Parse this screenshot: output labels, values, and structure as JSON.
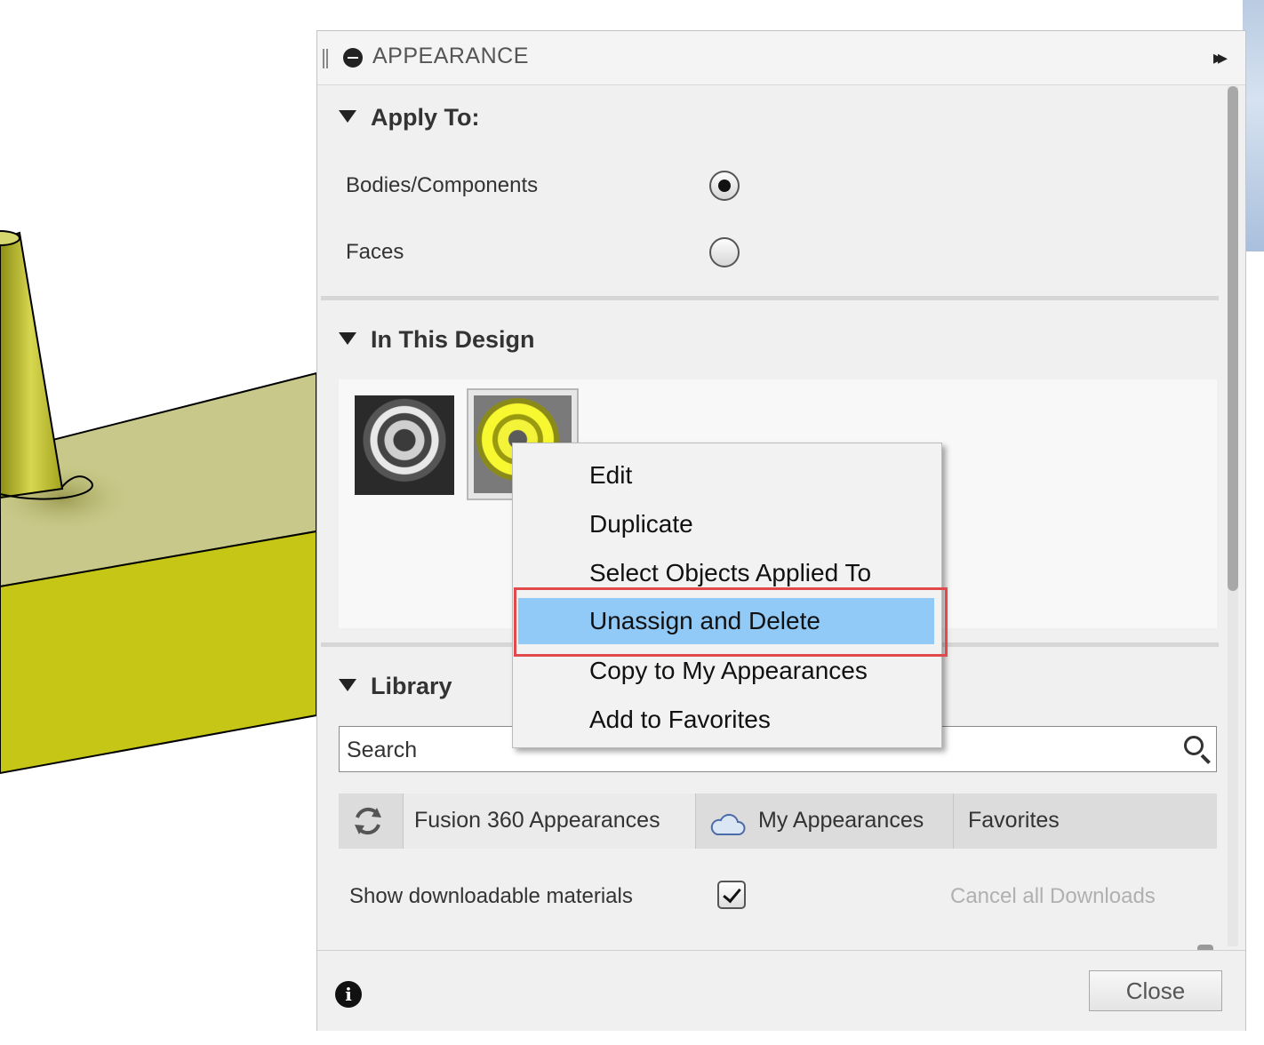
{
  "panel": {
    "title": "APPEARANCE",
    "expand_glyph": "▸▸"
  },
  "apply_to": {
    "heading": "Apply To:",
    "options": [
      {
        "label": "Bodies/Components",
        "selected": true
      },
      {
        "label": "Faces",
        "selected": false
      }
    ]
  },
  "in_this_design": {
    "heading": "In This Design",
    "swatches": [
      "chrome",
      "yellow"
    ]
  },
  "context_menu": {
    "items": [
      "Edit",
      "Duplicate",
      "Select Objects Applied To",
      "Unassign and Delete",
      "Copy to My Appearances",
      "Add to Favorites"
    ],
    "highlighted": "Unassign and Delete",
    "highlight_color": "#91c9f7",
    "annotation_color": "#e04a4a"
  },
  "library": {
    "heading": "Library",
    "search_placeholder": "Search",
    "tabs": [
      "Fusion 360 Appearances",
      "My Appearances",
      "Favorites"
    ],
    "active_tab": "Fusion 360 Appearances",
    "show_downloadable_label": "Show downloadable materials",
    "show_downloadable_checked": true,
    "cancel_downloads_label": "Cancel all Downloads"
  },
  "footer": {
    "info_glyph": "i",
    "close_label": "Close"
  },
  "model": {
    "color": "#c9c930"
  }
}
